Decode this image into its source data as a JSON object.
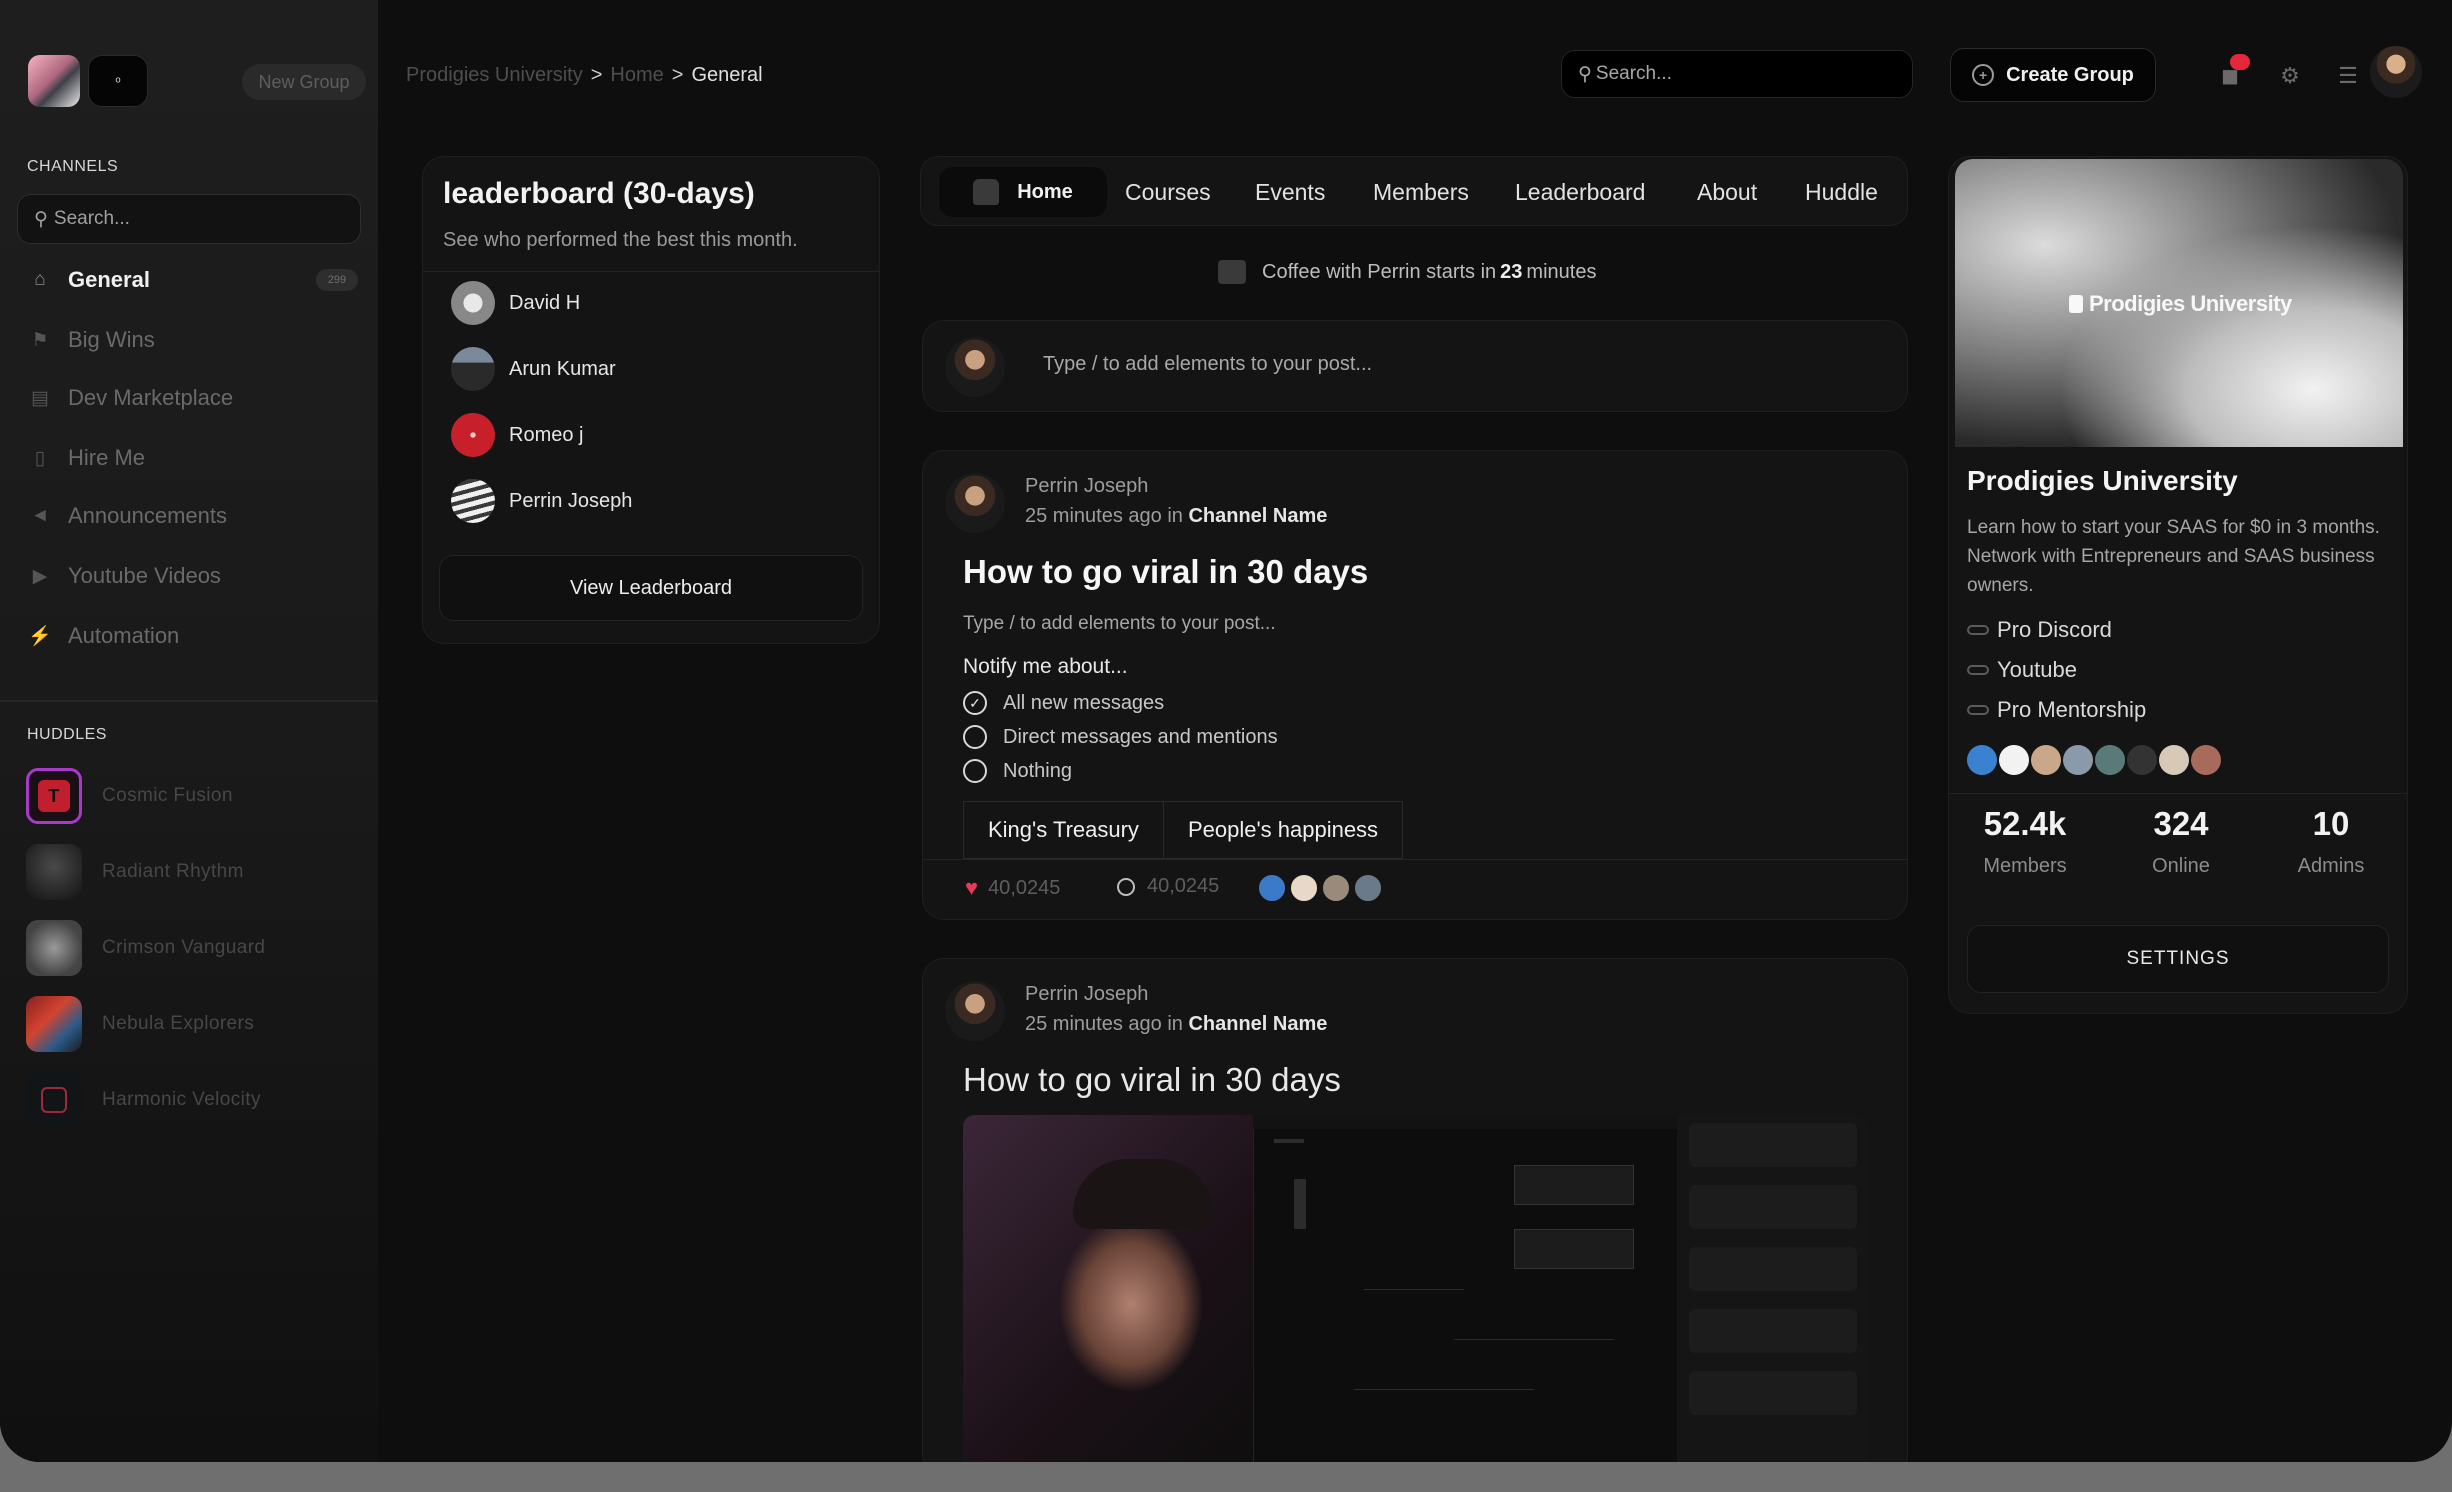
{
  "sidebar": {
    "new_group_label": "New Group",
    "logo_button_glyph": "ᵒ",
    "channels_title": "CHANNELS",
    "search_placeholder": "Search...",
    "channels": [
      {
        "label": "General",
        "icon": "home-icon",
        "active": true,
        "badge": "299"
      },
      {
        "label": "Big Wins",
        "icon": "trophy-icon"
      },
      {
        "label": "Dev Marketplace",
        "icon": "store-icon"
      },
      {
        "label": "Hire Me",
        "icon": "document-icon"
      },
      {
        "label": "Announcements",
        "icon": "megaphone-icon"
      },
      {
        "label": "Youtube Videos",
        "icon": "youtube-icon"
      },
      {
        "label": "Automation",
        "icon": "bolt-icon"
      }
    ],
    "huddles_title": "HUDDLES",
    "huddles": [
      {
        "label": "Cosmic Fusion",
        "avatar_letter": "T"
      },
      {
        "label": "Radiant Rhythm"
      },
      {
        "label": "Crimson Vanguard"
      },
      {
        "label": "Nebula Explorers"
      },
      {
        "label": "Harmonic Velocity"
      }
    ]
  },
  "topbar": {
    "breadcrumb": [
      "Prodigies University",
      "Home",
      "General"
    ],
    "breadcrumb_separator": ">",
    "search_placeholder": "Search...",
    "create_group_label": "Create Group",
    "notification_color": "#e4273a"
  },
  "leaderboard": {
    "title": "leaderboard (30-days)",
    "subtitle": "See who performed the best this month.",
    "entries": [
      "David H",
      "Arun Kumar",
      "Romeo j",
      "Perrin Joseph"
    ],
    "button_label": "View Leaderboard"
  },
  "nav_tabs": [
    "Home",
    "Courses",
    "Events",
    "Members",
    "Leaderboard",
    "About",
    "Huddle"
  ],
  "event_banner": {
    "prefix": "Coffee with Perrin starts in",
    "value": "23",
    "suffix": "minutes"
  },
  "composer": {
    "placeholder": "Type / to add elements to your post..."
  },
  "posts": [
    {
      "author": "Perrin Joseph",
      "time": "25 minutes ago in",
      "channel": "Channel Name",
      "title": "How to go viral in 30 days",
      "hint": "Type / to add elements to your post...",
      "notify_label": "Notify me about...",
      "options": [
        {
          "label": "All new messages",
          "checked": true
        },
        {
          "label": "Direct messages and mentions",
          "checked": false
        },
        {
          "label": "Nothing",
          "checked": false
        }
      ],
      "segments": [
        "King's Treasury",
        "People's happiness"
      ],
      "likes": "40,0245",
      "comments": "40,0245",
      "like_color": "#e53a5a"
    },
    {
      "author": "Perrin Joseph",
      "time": "25 minutes ago in",
      "channel": "Channel Name",
      "title": "How to go viral in 30 days"
    }
  ],
  "group": {
    "banner_text": "Prodigies University",
    "name": "Prodigies University",
    "description": "Learn how to start your SAAS for $0 in 3 months. Network with Entrepreneurs and SAAS business owners.",
    "links": [
      "Pro Discord",
      "Youtube",
      "Pro Mentorship"
    ],
    "stats": [
      {
        "value": "52.4k",
        "label": "Members"
      },
      {
        "value": "324",
        "label": "Online"
      },
      {
        "value": "10",
        "label": "Admins"
      }
    ],
    "settings_label": "SETTINGS"
  }
}
